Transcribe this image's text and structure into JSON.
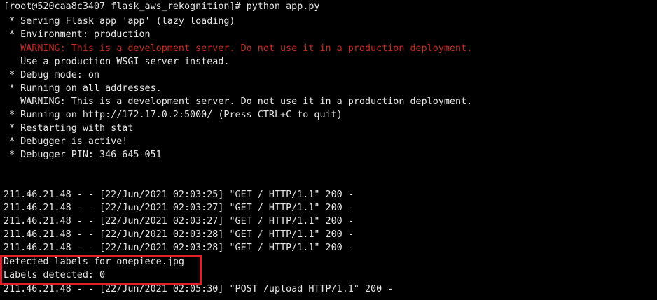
{
  "terminal": {
    "prompt": "[root@520caa8c3407 flask_aws_rekognition]# python app.py",
    "serving": " * Serving Flask app 'app' (lazy loading)",
    "environment": " * Environment: production",
    "warning_red": "   WARNING: This is a development server. Do not use it in a production deployment.",
    "use_wsgi": "   Use a production WSGI server instead.",
    "debug_mode": " * Debug mode: on",
    "running_all": " * Running on all addresses.",
    "warning_white": "   WARNING: This is a development server. Do not use it in a production deployment.",
    "running_on": " * Running on http://172.17.0.2:5000/ (Press CTRL+C to quit)",
    "restarting": " * Restarting with stat",
    "debugger_active": " * Debugger is active!",
    "debugger_pin": " * Debugger PIN: 346-645-051",
    "log_lines": [
      "211.46.21.48 - - [22/Jun/2021 02:03:25] \"GET / HTTP/1.1\" 200 -",
      "211.46.21.48 - - [22/Jun/2021 02:03:27] \"GET / HTTP/1.1\" 200 -",
      "211.46.21.48 - - [22/Jun/2021 02:03:27] \"GET / HTTP/1.1\" 200 -",
      "211.46.21.48 - - [22/Jun/2021 02:03:28] \"GET / HTTP/1.1\" 200 -",
      "211.46.21.48 - - [22/Jun/2021 02:03:28] \"GET / HTTP/1.1\" 200 -"
    ],
    "detected_labels": "Detected labels for onepiece.jpg",
    "labels_count": "Labels detected: 0",
    "post_line": "211.46.21.48 - - [22/Jun/2021 02:05:30] \"POST /upload HTTP/1.1\" 200 -"
  },
  "colors": {
    "background": "#000000",
    "text": "#e6e6e6",
    "warning": "#c42d22",
    "highlight": "#e0202a"
  }
}
